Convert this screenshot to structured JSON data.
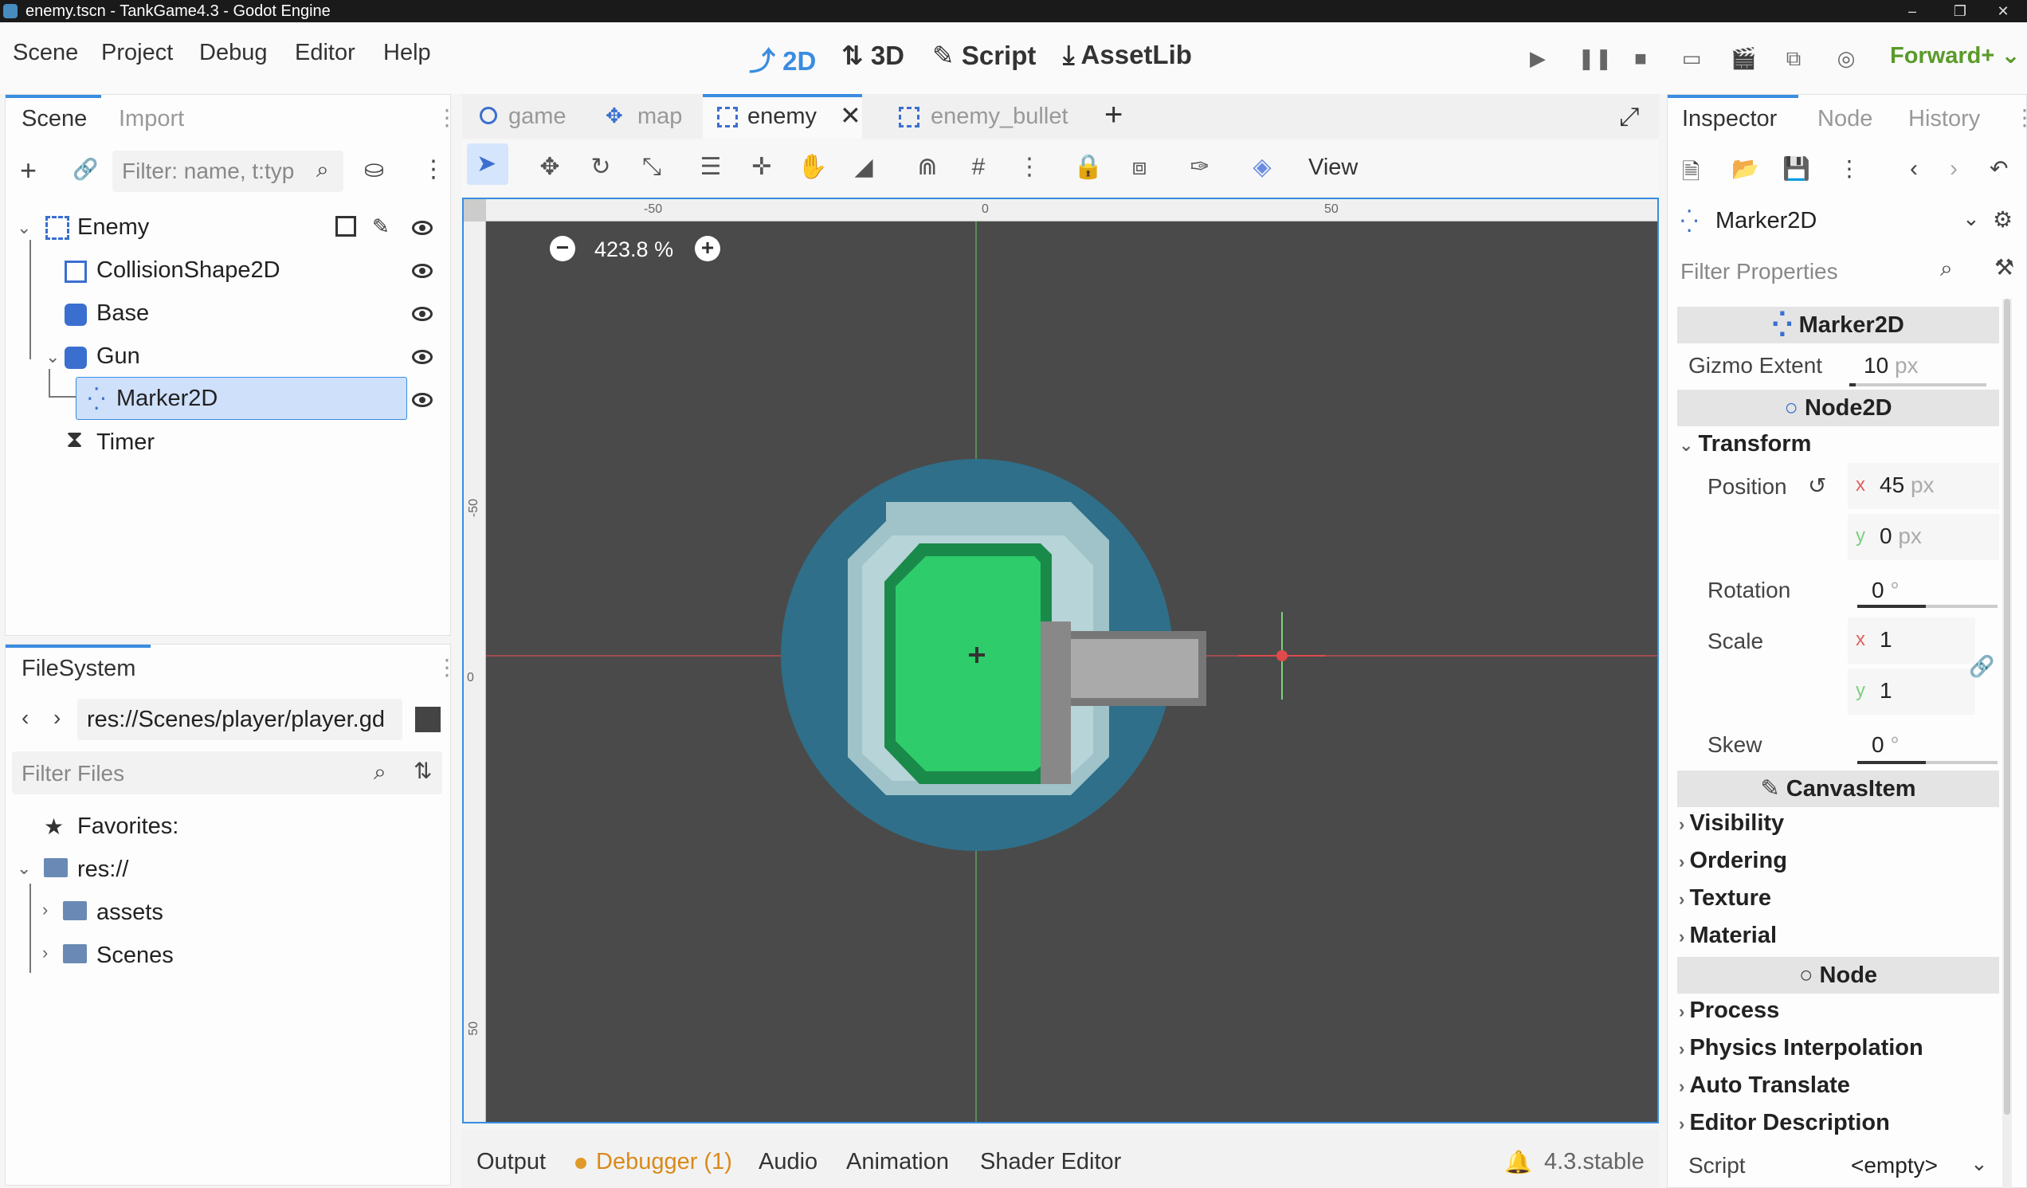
{
  "window": {
    "title": "enemy.tscn - TankGame4.3 - Godot Engine"
  },
  "menu": {
    "items": [
      "Scene",
      "Project",
      "Debug",
      "Editor",
      "Help"
    ]
  },
  "modes": {
    "d2": "2D",
    "d3": "3D",
    "script": "Script",
    "assetlib": "AssetLib"
  },
  "renderer": "Forward+",
  "scene_dock": {
    "tabs": [
      "Scene",
      "Import"
    ],
    "filter_placeholder": "Filter: name, t:typ",
    "nodes": [
      {
        "label": "Enemy",
        "icon": "node2d-icon",
        "depth": 0
      },
      {
        "label": "CollisionShape2D",
        "icon": "collision-shape-icon",
        "depth": 1
      },
      {
        "label": "Base",
        "icon": "sprite-icon",
        "depth": 1
      },
      {
        "label": "Gun",
        "icon": "sprite-icon",
        "depth": 1
      },
      {
        "label": "Marker2D",
        "icon": "marker-icon",
        "depth": 2,
        "selected": true
      },
      {
        "label": "Timer",
        "icon": "timer-icon",
        "depth": 1
      }
    ]
  },
  "filesystem": {
    "tab": "FileSystem",
    "path": "res://Scenes/player/player.gd",
    "filter_placeholder": "Filter Files",
    "items": [
      "Favorites:",
      "res://",
      "assets",
      "Scenes"
    ]
  },
  "editor_tabs": [
    "game",
    "map",
    "enemy",
    "enemy_bullet"
  ],
  "active_tab": "enemy",
  "toolbar": {
    "view_label": "View"
  },
  "viewport": {
    "zoom": "423.8 %",
    "ruler_top": [
      "-50",
      "0",
      "50"
    ],
    "ruler_left": [
      "-50",
      "0",
      "50"
    ],
    "accent": "#3a8ce0",
    "bg": "#4a4a4a"
  },
  "bottom_panel": {
    "tabs": [
      "Output",
      "Debugger (1)",
      "Audio",
      "Animation",
      "Shader Editor"
    ],
    "version": "4.3.stable"
  },
  "inspector": {
    "tabs": [
      "Inspector",
      "Node",
      "History"
    ],
    "node_type": "Marker2D",
    "filter_placeholder": "Filter Properties",
    "sections": {
      "marker": "Marker2D",
      "node2d": "Node2D",
      "canvas": "CanvasItem",
      "node": "Node"
    },
    "gizmo_extent": {
      "label": "Gizmo Extent",
      "value": "10",
      "unit": "px"
    },
    "transform": {
      "label": "Transform",
      "position_label": "Position",
      "pos_x": "45",
      "pos_y": "0",
      "unit": "px",
      "rotation_label": "Rotation",
      "rotation": "0",
      "scale_label": "Scale",
      "scale_x": "1",
      "scale_y": "1",
      "skew_label": "Skew",
      "skew": "0",
      "deg": "°",
      "x": "x",
      "y": "y"
    },
    "canvas_subs": [
      "Visibility",
      "Ordering",
      "Texture",
      "Material"
    ],
    "node_subs": [
      "Process",
      "Physics Interpolation",
      "Auto Translate",
      "Editor Description"
    ],
    "script_label": "Script",
    "script_value": "<empty>"
  }
}
